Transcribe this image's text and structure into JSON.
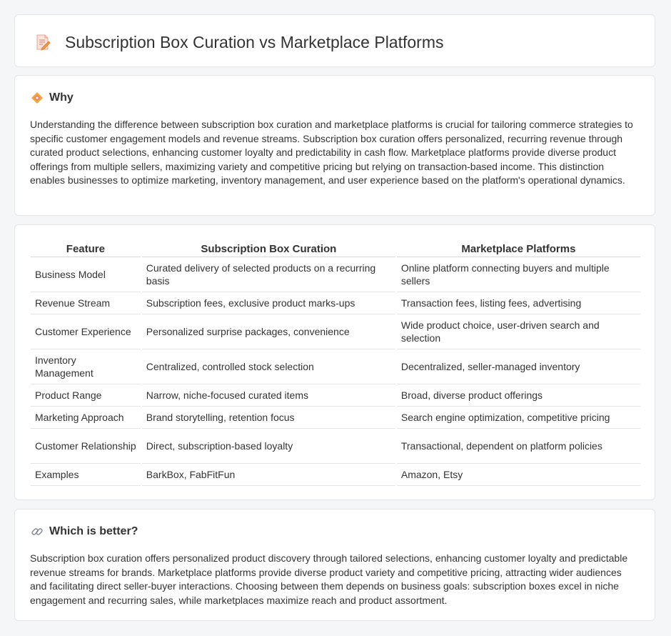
{
  "header": {
    "title": "Subscription Box Curation vs Marketplace Platforms",
    "icon": "document-pen-icon"
  },
  "why": {
    "heading": "Why",
    "icon": "diamond-icon",
    "text": "Understanding the difference between subscription box curation and marketplace platforms is crucial for tailoring commerce strategies to specific customer engagement models and revenue streams. Subscription box curation offers personalized, recurring revenue through curated product selections, enhancing customer loyalty and predictability in cash flow. Marketplace platforms provide diverse product offerings from multiple sellers, maximizing variety and competitive pricing but relying on transaction-based income. This distinction enables businesses to optimize marketing, inventory management, and user experience based on the platform's operational dynamics."
  },
  "table": {
    "headers": [
      "Feature",
      "Subscription Box Curation",
      "Marketplace Platforms"
    ],
    "rows": [
      [
        "Business Model",
        "Curated delivery of selected products on a recurring basis",
        "Online platform connecting buyers and multiple sellers"
      ],
      [
        "Revenue Stream",
        "Subscription fees, exclusive product marks-ups",
        "Transaction fees, listing fees, advertising"
      ],
      [
        "Customer Experience",
        "Personalized surprise packages, convenience",
        "Wide product choice, user-driven search and selection"
      ],
      [
        "Inventory Management",
        "Centralized, controlled stock selection",
        "Decentralized, seller-managed inventory"
      ],
      [
        "Product Range",
        "Narrow, niche-focused curated items",
        "Broad, diverse product offerings"
      ],
      [
        "Marketing Approach",
        "Brand storytelling, retention focus",
        "Search engine optimization, competitive pricing"
      ],
      [
        "Customer Relationship",
        "Direct, subscription-based loyalty",
        "Transactional, dependent on platform policies"
      ],
      [
        "Examples",
        "BarkBox, FabFitFun",
        "Amazon, Etsy"
      ]
    ]
  },
  "better": {
    "heading": "Which is better?",
    "icon": "link-icon",
    "text": "Subscription box curation offers personalized product discovery through tailored selections, enhancing customer loyalty and predictable revenue streams for brands. Marketplace platforms provide diverse product variety and competitive pricing, attracting wider audiences and facilitating direct seller-buyer interactions. Choosing between them depends on business goals: subscription boxes excel in niche engagement and recurring sales, while marketplaces maximize reach and product assortment."
  },
  "colors": {
    "background": "#f5f6f8",
    "card": "#ffffff",
    "text": "#333333",
    "accent_orange": "#f4a53a",
    "accent_pink": "#e8766a"
  }
}
